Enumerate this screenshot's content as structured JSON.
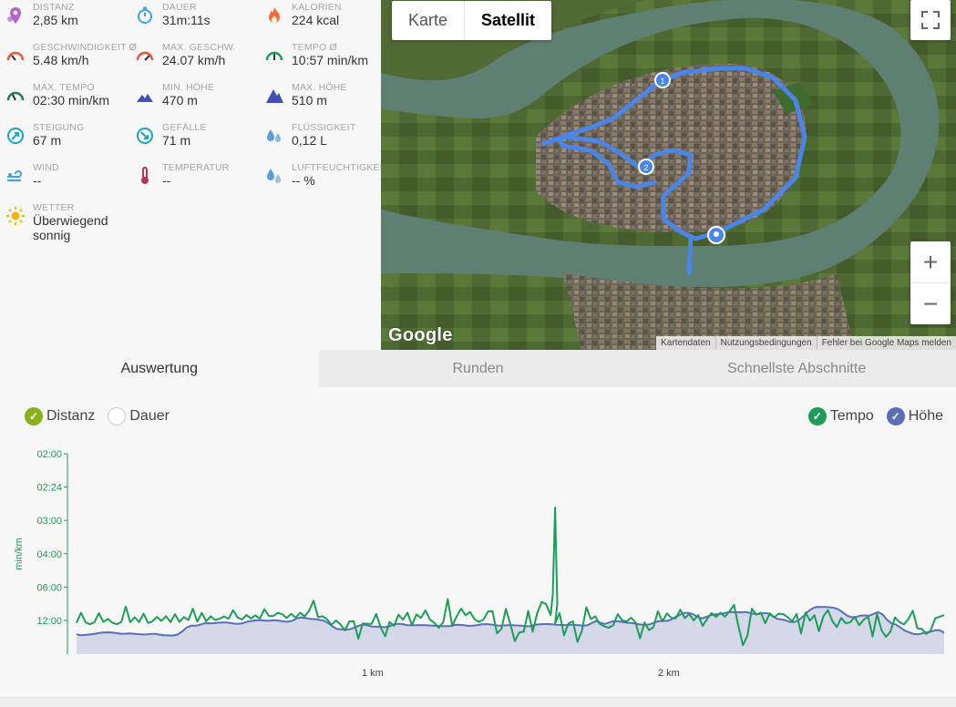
{
  "stats": [
    {
      "label": "Distanz",
      "value": "2,85 km",
      "icon": "pin-icon",
      "color": "#b266c9"
    },
    {
      "label": "Dauer",
      "value": "31m:11s",
      "icon": "stopwatch-icon",
      "color": "#3fa3e0"
    },
    {
      "label": "Kalorien",
      "value": "224 kcal",
      "icon": "flame-icon",
      "color": "#ef6c3d"
    },
    {
      "label": "Geschwindigkeit Ø",
      "value": "5.48 km/h",
      "icon": "speedometer-icon",
      "color": "#e25a3a"
    },
    {
      "label": "Max. Geschw.",
      "value": "24.07 km/h",
      "icon": "speedometer-max-icon",
      "color": "#e25a3a"
    },
    {
      "label": "Tempo Ø",
      "value": "10:57 min/km",
      "icon": "tempo-gauge-icon",
      "color": "#1e9d5a"
    },
    {
      "label": "Max. Tempo",
      "value": "02:30 min/km",
      "icon": "max-tempo-gauge-icon",
      "color": "#1e7d5a"
    },
    {
      "label": "Min. Höhe",
      "value": "470 m",
      "icon": "mountain-low-icon",
      "color": "#3f51b5"
    },
    {
      "label": "Max. Höhe",
      "value": "510 m",
      "icon": "mountain-high-icon",
      "color": "#3f51b5"
    },
    {
      "label": "Steigung",
      "value": "67 m",
      "icon": "ascent-icon",
      "color": "#1ea3c9"
    },
    {
      "label": "Gefälle",
      "value": "71 m",
      "icon": "descent-icon",
      "color": "#1ea3c9"
    },
    {
      "label": "Flüssigkeit",
      "value": "0,12 L",
      "icon": "drops-icon",
      "color": "#5a9de0"
    },
    {
      "label": "Wind",
      "value": "--",
      "icon": "wind-icon",
      "color": "#3fa3e0"
    },
    {
      "label": "Temperatur",
      "value": "--",
      "icon": "thermometer-icon",
      "color": "#b0385a"
    },
    {
      "label": "Luftfeuchtigkeit",
      "value": "-- %",
      "icon": "humidity-icon",
      "color": "#5a9de0"
    },
    {
      "label": "Wetter",
      "value": "Überwiegend sonnig",
      "icon": "sun-icon",
      "color": "#f4b400"
    }
  ],
  "map": {
    "toggle": [
      "Karte",
      "Satellit"
    ],
    "active": "Satellit",
    "logo": "Google",
    "attribution": [
      "Kartendaten",
      "Nutzungsbedingungen",
      "Fehler bei Google Maps melden"
    ],
    "markers": [
      "1",
      "2"
    ]
  },
  "tabs": [
    "Auswertung",
    "Runden",
    "Schnellste Abschnitte"
  ],
  "activeTab": "Auswertung",
  "chartToggles": {
    "left": [
      {
        "label": "Distanz",
        "checked": true,
        "color": "#8bb01e"
      },
      {
        "label": "Dauer",
        "checked": false,
        "color": "#ffffff"
      }
    ],
    "right": [
      {
        "label": "Tempo",
        "checked": true,
        "color": "#1e9d5a"
      },
      {
        "label": "Höhe",
        "checked": true,
        "color": "#5a6fb5"
      }
    ]
  },
  "chart_data": {
    "type": "line",
    "ylabel": "min/km",
    "yticks": [
      "02:00",
      "02:24",
      "03:00",
      "04:00",
      "06:00",
      "12:00"
    ],
    "xticks": [
      {
        "label": "1 km",
        "km": 1
      },
      {
        "label": "2 km",
        "km": 2
      }
    ],
    "xlim": [
      0,
      2.93
    ],
    "series": [
      {
        "name": "Tempo",
        "color": "#1e9d5a",
        "values": [
          84.4,
          79.3,
          84.1,
          85.1,
          84.1,
          79.5,
          83.9,
          82.4,
          84.3,
          85.1,
          83.9,
          76.3,
          84.1,
          81.6,
          84.0,
          79.8,
          84.4,
          83.6,
          81.4,
          83.4,
          81.0,
          84.0,
          80.1,
          83.9,
          81.5,
          83.0,
          77.3,
          83.8,
          79.4,
          83.6,
          81.1,
          83.0,
          82.3,
          81.2,
          82.3,
          78.1,
          81.7,
          82.7,
          80.5,
          82.2,
          80.7,
          82.2,
          77.6,
          80.9,
          81.0,
          79.4,
          80.1,
          81.9,
          79.9,
          81.8,
          79.3,
          81.2,
          78.3,
          73.3,
          81.5,
          81.1,
          82.6,
          85.3,
          83.2,
          85.1,
          88.2,
          83.7,
          83.6,
          92.3,
          84.7,
          84.9,
          84.8,
          80.0,
          86.7,
          91.1,
          84.0,
          85.9,
          80.3,
          82.8,
          79.3,
          85.6,
          80.2,
          81.9,
          78.2,
          82.7,
          84.4,
          86.8,
          84.0,
          72.5,
          86.0,
          81.2,
          77.3,
          80.6,
          78.9,
          82.6,
          83.9,
          82.7,
          78.7,
          78.6,
          89.6,
          87.4,
          77.4,
          85.0,
          93.5,
          89.2,
          88.8,
          78.4,
          88.8,
          79.6,
          74.0,
          75.1,
          80.5,
          84.6,
          79.5,
          90.6,
          84.7,
          83.6,
          93.9,
          88.4,
          76.6,
          82.5,
          81.2,
          84.9,
          86.1,
          86.8,
          85.6,
          80.1,
          83.2,
          83.7,
          81.8,
          84.2,
          92.1,
          84.2,
          88.0,
          86.6,
          78.6,
          83.7,
          79.7,
          81.9,
          82.1,
          77.8,
          82.0,
          80.0,
          83.2,
          80.5,
          85.9,
          82.4,
          79.5,
          81.4,
          79.3,
          81.3,
          78.6,
          75.4,
          86.1,
          95.5,
          90.8,
          77.3,
          80.3,
          79.3,
          84.6,
          79.6,
          81.6,
          79.8,
          80.0,
          81.5,
          83.6,
          79.9,
          89.7,
          79.2,
          83.3,
          80.6,
          88.5,
          81.1,
          78.0,
          83.4,
          86.5,
          81.9,
          84.6,
          84.1,
          81.5,
          85.6,
          82.8,
          81.3,
          91.2,
          80.0,
          88.1,
          91.4,
          88.7,
          81.7,
          84.0,
          85.2,
          82.5,
          78.3,
          87.1,
          87.4,
          89.9,
          88.1,
          82.1,
          81.3,
          80.5
        ],
        "peak": {
          "at": 0.55,
          "value": 26.9
        }
      },
      {
        "name": "Höhe",
        "color": "#5a6fb5",
        "values": [
          90.1,
          90.6,
          90.4,
          90.2,
          89.9,
          89.5,
          89.2,
          89.1,
          89.2,
          89.5,
          89.8,
          89.8,
          89.7,
          89.8,
          90.0,
          90.2,
          90.1,
          89.9,
          89.9,
          90.3,
          90.6,
          90.7,
          90.7,
          90.2,
          88.7,
          86.7,
          85.8,
          85.8,
          85.4,
          84.6,
          84.6,
          84.6,
          84.3,
          84.2,
          84.2,
          84.5,
          84.8,
          84.8,
          84.4,
          83.7,
          83.3,
          83.1,
          83.1,
          83.3,
          83.3,
          83.1,
          83.3,
          83.7,
          83.8,
          83.3,
          82.2,
          81.7,
          82.0,
          82.4,
          82.5,
          82.8,
          83.2,
          84.3,
          85.9,
          87.3,
          87.6,
          87.8,
          87.6,
          86.8,
          85.9,
          85.2,
          85.6,
          86.2,
          86.3,
          86.3,
          86.6,
          86.1,
          85.2,
          84.9,
          85.0,
          85.5,
          85.6,
          85.6,
          85.5,
          85.5,
          85.7,
          85.8,
          85.9,
          86.0,
          86.0,
          85.9,
          85.4,
          85.3,
          85.6,
          85.9,
          85.8,
          85.5,
          85.1,
          85.0,
          85.2,
          85.6,
          85.8,
          85.7,
          85.5,
          85.6,
          85.7,
          85.8,
          86.1,
          86.0,
          85.4,
          85.1,
          85.0,
          85.0,
          85.1,
          85.3,
          85.4,
          85.5,
          85.4,
          85.4,
          85.6,
          85.8,
          85.6,
          84.4,
          83.5,
          84.4,
          84.9,
          84.2,
          83.5,
          83.6,
          84.0,
          84.3,
          84.4,
          84.8,
          85.2,
          85.5,
          85.2,
          84.4,
          83.6,
          83.4,
          83.4,
          82.8,
          81.4,
          80.3,
          79.4,
          79.4,
          80.1,
          81.4,
          82.2,
          81.4,
          80.6,
          80.2,
          80.0,
          79.6,
          79.1,
          79.0,
          79.1,
          79.1,
          79.0,
          79.5,
          80.0,
          80.0,
          79.5,
          79.7,
          81.0,
          82.3,
          82.7,
          83.1,
          84.0,
          84.0,
          83.1,
          81.1,
          78.9,
          77.3,
          76.4,
          76.5,
          76.5,
          76.6,
          76.9,
          77.7,
          79.2,
          80.8,
          81.6,
          81.4,
          80.8,
          80.7,
          80.8,
          79.9,
          79.0,
          80.1,
          82.8,
          84.6,
          85.2,
          86.6,
          88.2,
          89.1,
          89.9,
          90.1,
          89.7,
          89.1,
          88.8,
          88.1,
          88.1,
          89.3
        ]
      }
    ]
  }
}
